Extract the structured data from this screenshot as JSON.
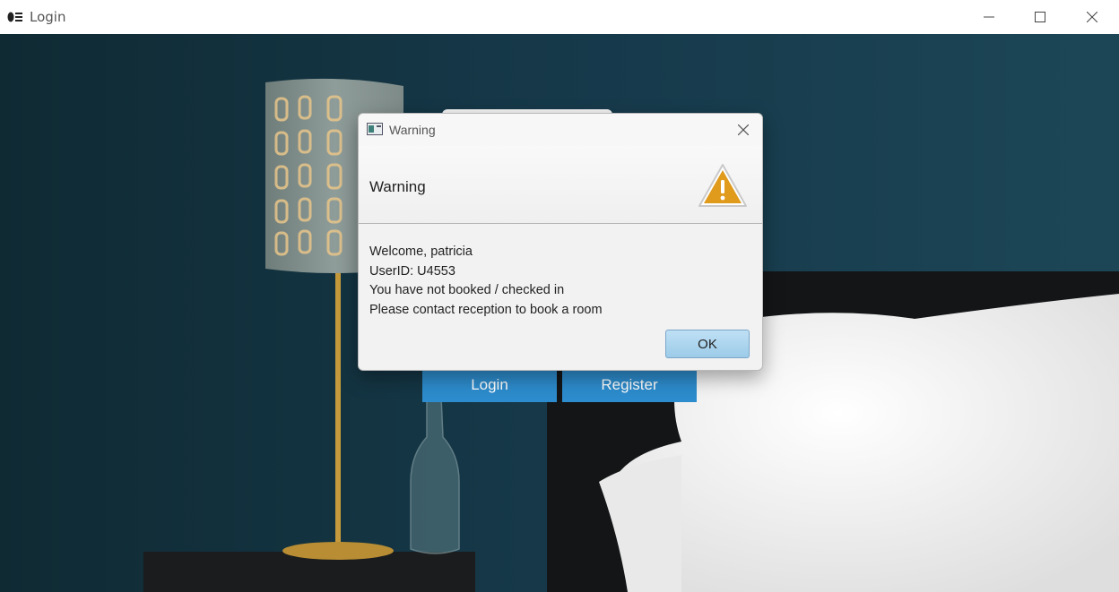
{
  "window": {
    "title": "Login",
    "logo_icon": "hotel-logo-icon",
    "controls": [
      "minimize-icon",
      "maximize-icon",
      "close-icon"
    ]
  },
  "login_form": {
    "login_label": "Login",
    "register_label": "Register"
  },
  "dialog": {
    "title": "Warning",
    "header": "Warning",
    "header_icon": "warning-triangle-icon",
    "lines": [
      "Welcome, patricia",
      "UserID: U4553",
      "You have not booked / checked in",
      "Please contact reception to book a room"
    ],
    "ok_label": "OK"
  },
  "colors": {
    "primary_button": "#2d8ccd",
    "ok_button": "#a9d4ee",
    "warning": "#e09a1c",
    "wall": "#173a44"
  }
}
